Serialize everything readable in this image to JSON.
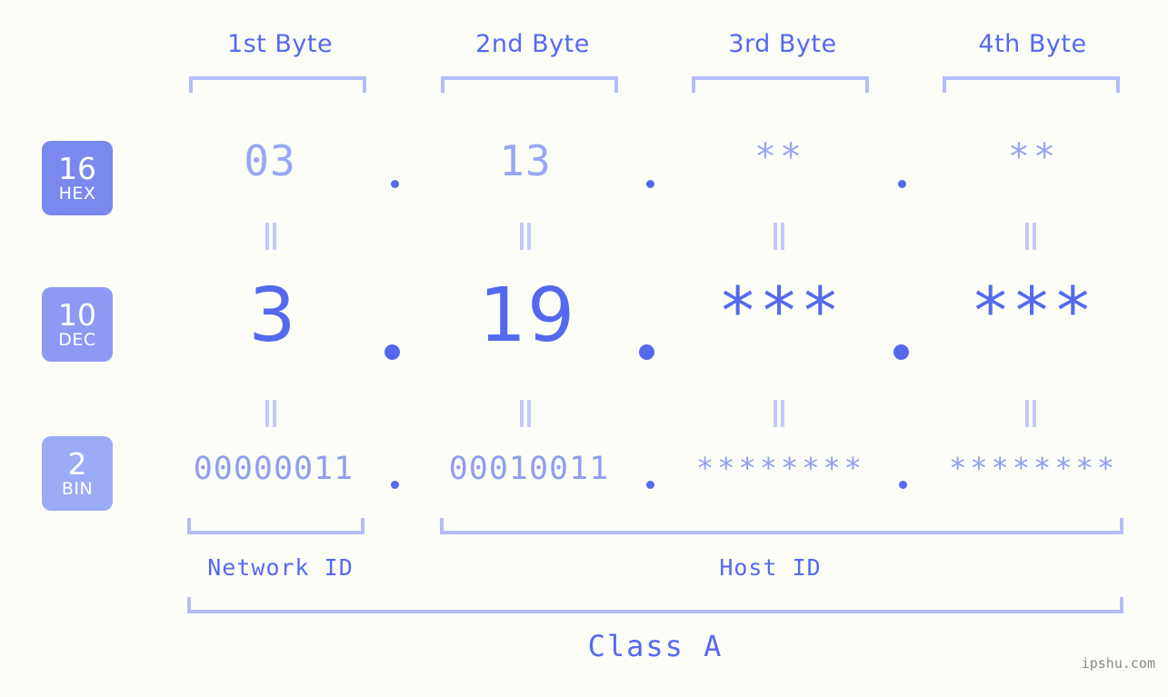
{
  "bytes": {
    "headers": [
      "1st Byte",
      "2nd Byte",
      "3rd Byte",
      "4th Byte"
    ]
  },
  "radix_badges": [
    {
      "number": "16",
      "name": "HEX",
      "color": "#7b88ee"
    },
    {
      "number": "10",
      "name": "DEC",
      "color": "#8e99f3"
    },
    {
      "number": "2",
      "name": "BIN",
      "color": "#9cabf5"
    }
  ],
  "rows": {
    "hex": {
      "label": "HEX",
      "values": [
        "03",
        "13",
        "**",
        "**"
      ]
    },
    "dec": {
      "label": "DEC",
      "values": [
        "3",
        "19",
        "***",
        "***"
      ]
    },
    "bin": {
      "label": "BIN",
      "values": [
        "00000011",
        "00010011",
        "********",
        "********"
      ]
    }
  },
  "separators": {
    "dot": ".",
    "equals": "||"
  },
  "segments": {
    "network_id": "Network ID",
    "host_id": "Host ID",
    "class": "Class A"
  },
  "watermark": "ipshu.com",
  "colors": {
    "background": "#fcfdf7",
    "accent": "#5569ee",
    "accent_light": "#98a6f4",
    "bracket": "#b4bdf7",
    "equals": "#c3caf9",
    "watermark": "#8a8a8a"
  }
}
